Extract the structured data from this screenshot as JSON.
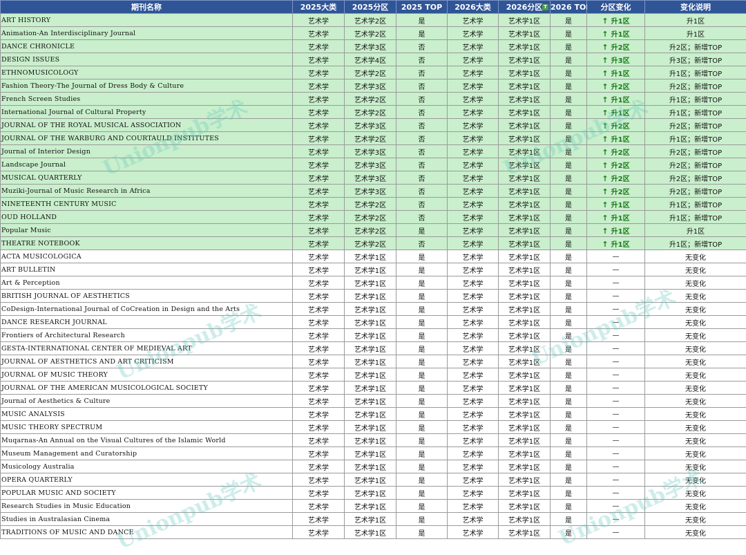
{
  "headers": [
    "期刊名称",
    "2025大类",
    "2025分区",
    "2025 TOP",
    "2026大类",
    "2026分区",
    "2026 TOP",
    "分区变化",
    "变化说明"
  ],
  "filter_icon": "filter-icon",
  "colors": {
    "header_bg": "#2f5597",
    "up_row_bg": "#c9efcc",
    "up_text": "#1a7a1a"
  },
  "watermark": "Unionpub学术",
  "rows": [
    {
      "name": "ART HISTORY",
      "c25": "艺术学",
      "q25": "艺术学2区",
      "t25": "是",
      "c26": "艺术学",
      "q26": "艺术学1区",
      "t26": "是",
      "chg": "升1区",
      "note": "升1区",
      "up": true
    },
    {
      "name": "Animation-An Interdisciplinary Journal",
      "c25": "艺术学",
      "q25": "艺术学2区",
      "t25": "是",
      "c26": "艺术学",
      "q26": "艺术学1区",
      "t26": "是",
      "chg": "升1区",
      "note": "升1区",
      "up": true
    },
    {
      "name": "DANCE CHRONICLE",
      "c25": "艺术学",
      "q25": "艺术学3区",
      "t25": "否",
      "c26": "艺术学",
      "q26": "艺术学1区",
      "t26": "是",
      "chg": "升2区",
      "note": "升2区；新增TOP",
      "up": true
    },
    {
      "name": "DESIGN ISSUES",
      "c25": "艺术学",
      "q25": "艺术学4区",
      "t25": "否",
      "c26": "艺术学",
      "q26": "艺术学1区",
      "t26": "是",
      "chg": "升3区",
      "note": "升3区；新增TOP",
      "up": true
    },
    {
      "name": "ETHNOMUSICOLOGY",
      "c25": "艺术学",
      "q25": "艺术学2区",
      "t25": "否",
      "c26": "艺术学",
      "q26": "艺术学1区",
      "t26": "是",
      "chg": "升1区",
      "note": "升1区；新增TOP",
      "up": true
    },
    {
      "name": "Fashion Theory-The Journal of Dress Body & Culture",
      "c25": "艺术学",
      "q25": "艺术学3区",
      "t25": "否",
      "c26": "艺术学",
      "q26": "艺术学1区",
      "t26": "是",
      "chg": "升2区",
      "note": "升2区；新增TOP",
      "up": true
    },
    {
      "name": "French Screen Studies",
      "c25": "艺术学",
      "q25": "艺术学2区",
      "t25": "否",
      "c26": "艺术学",
      "q26": "艺术学1区",
      "t26": "是",
      "chg": "升1区",
      "note": "升1区；新增TOP",
      "up": true
    },
    {
      "name": "International Journal of Cultural Property",
      "c25": "艺术学",
      "q25": "艺术学2区",
      "t25": "否",
      "c26": "艺术学",
      "q26": "艺术学1区",
      "t26": "是",
      "chg": "升1区",
      "note": "升1区；新增TOP",
      "up": true
    },
    {
      "name": "JOURNAL OF THE ROYAL MUSICAL ASSOCIATION",
      "c25": "艺术学",
      "q25": "艺术学3区",
      "t25": "否",
      "c26": "艺术学",
      "q26": "艺术学1区",
      "t26": "是",
      "chg": "升2区",
      "note": "升2区；新增TOP",
      "up": true
    },
    {
      "name": "JOURNAL OF THE WARBURG AND COURTAULD INSTITUTES",
      "c25": "艺术学",
      "q25": "艺术学2区",
      "t25": "否",
      "c26": "艺术学",
      "q26": "艺术学1区",
      "t26": "是",
      "chg": "升1区",
      "note": "升1区；新增TOP",
      "up": true
    },
    {
      "name": "Journal of Interior Design",
      "c25": "艺术学",
      "q25": "艺术学3区",
      "t25": "否",
      "c26": "艺术学",
      "q26": "艺术学1区",
      "t26": "是",
      "chg": "升2区",
      "note": "升2区；新增TOP",
      "up": true
    },
    {
      "name": "Landscape Journal",
      "c25": "艺术学",
      "q25": "艺术学3区",
      "t25": "否",
      "c26": "艺术学",
      "q26": "艺术学1区",
      "t26": "是",
      "chg": "升2区",
      "note": "升2区；新增TOP",
      "up": true
    },
    {
      "name": "MUSICAL QUARTERLY",
      "c25": "艺术学",
      "q25": "艺术学3区",
      "t25": "否",
      "c26": "艺术学",
      "q26": "艺术学1区",
      "t26": "是",
      "chg": "升2区",
      "note": "升2区；新增TOP",
      "up": true
    },
    {
      "name": "Muziki-Journal of Music Research in Africa",
      "c25": "艺术学",
      "q25": "艺术学3区",
      "t25": "否",
      "c26": "艺术学",
      "q26": "艺术学1区",
      "t26": "是",
      "chg": "升2区",
      "note": "升2区；新增TOP",
      "up": true
    },
    {
      "name": "NINETEENTH CENTURY MUSIC",
      "c25": "艺术学",
      "q25": "艺术学2区",
      "t25": "否",
      "c26": "艺术学",
      "q26": "艺术学1区",
      "t26": "是",
      "chg": "升1区",
      "note": "升1区；新增TOP",
      "up": true
    },
    {
      "name": "OUD HOLLAND",
      "c25": "艺术学",
      "q25": "艺术学2区",
      "t25": "否",
      "c26": "艺术学",
      "q26": "艺术学1区",
      "t26": "是",
      "chg": "升1区",
      "note": "升1区；新增TOP",
      "up": true
    },
    {
      "name": "Popular Music",
      "c25": "艺术学",
      "q25": "艺术学2区",
      "t25": "是",
      "c26": "艺术学",
      "q26": "艺术学1区",
      "t26": "是",
      "chg": "升1区",
      "note": "升1区",
      "up": true
    },
    {
      "name": "THEATRE NOTEBOOK",
      "c25": "艺术学",
      "q25": "艺术学2区",
      "t25": "否",
      "c26": "艺术学",
      "q26": "艺术学1区",
      "t26": "是",
      "chg": "升1区",
      "note": "升1区；新增TOP",
      "up": true
    },
    {
      "name": "ACTA MUSICOLOGICA",
      "c25": "艺术学",
      "q25": "艺术学1区",
      "t25": "是",
      "c26": "艺术学",
      "q26": "艺术学1区",
      "t26": "是",
      "chg": "—",
      "note": "无变化",
      "up": false
    },
    {
      "name": "ART BULLETIN",
      "c25": "艺术学",
      "q25": "艺术学1区",
      "t25": "是",
      "c26": "艺术学",
      "q26": "艺术学1区",
      "t26": "是",
      "chg": "—",
      "note": "无变化",
      "up": false
    },
    {
      "name": "Art & Perception",
      "c25": "艺术学",
      "q25": "艺术学1区",
      "t25": "是",
      "c26": "艺术学",
      "q26": "艺术学1区",
      "t26": "是",
      "chg": "—",
      "note": "无变化",
      "up": false
    },
    {
      "name": "BRITISH JOURNAL OF AESTHETICS",
      "c25": "艺术学",
      "q25": "艺术学1区",
      "t25": "是",
      "c26": "艺术学",
      "q26": "艺术学1区",
      "t26": "是",
      "chg": "—",
      "note": "无变化",
      "up": false
    },
    {
      "name": "CoDesign-International Journal of CoCreation in Design and the Arts",
      "c25": "艺术学",
      "q25": "艺术学1区",
      "t25": "是",
      "c26": "艺术学",
      "q26": "艺术学1区",
      "t26": "是",
      "chg": "—",
      "note": "无变化",
      "up": false
    },
    {
      "name": "DANCE RESEARCH JOURNAL",
      "c25": "艺术学",
      "q25": "艺术学1区",
      "t25": "是",
      "c26": "艺术学",
      "q26": "艺术学1区",
      "t26": "是",
      "chg": "—",
      "note": "无变化",
      "up": false
    },
    {
      "name": "Frontiers of Architectural Research",
      "c25": "艺术学",
      "q25": "艺术学1区",
      "t25": "是",
      "c26": "艺术学",
      "q26": "艺术学1区",
      "t26": "是",
      "chg": "—",
      "note": "无变化",
      "up": false
    },
    {
      "name": "GESTA-INTERNATIONAL CENTER OF MEDIEVAL ART",
      "c25": "艺术学",
      "q25": "艺术学1区",
      "t25": "是",
      "c26": "艺术学",
      "q26": "艺术学1区",
      "t26": "是",
      "chg": "—",
      "note": "无变化",
      "up": false
    },
    {
      "name": "JOURNAL OF AESTHETICS AND ART CRITICISM",
      "c25": "艺术学",
      "q25": "艺术学1区",
      "t25": "是",
      "c26": "艺术学",
      "q26": "艺术学1区",
      "t26": "是",
      "chg": "—",
      "note": "无变化",
      "up": false
    },
    {
      "name": "JOURNAL OF MUSIC THEORY",
      "c25": "艺术学",
      "q25": "艺术学1区",
      "t25": "是",
      "c26": "艺术学",
      "q26": "艺术学1区",
      "t26": "是",
      "chg": "—",
      "note": "无变化",
      "up": false
    },
    {
      "name": "JOURNAL OF THE AMERICAN MUSICOLOGICAL SOCIETY",
      "c25": "艺术学",
      "q25": "艺术学1区",
      "t25": "是",
      "c26": "艺术学",
      "q26": "艺术学1区",
      "t26": "是",
      "chg": "—",
      "note": "无变化",
      "up": false
    },
    {
      "name": "Journal of Aesthetics & Culture",
      "c25": "艺术学",
      "q25": "艺术学1区",
      "t25": "是",
      "c26": "艺术学",
      "q26": "艺术学1区",
      "t26": "是",
      "chg": "—",
      "note": "无变化",
      "up": false
    },
    {
      "name": "MUSIC ANALYSIS",
      "c25": "艺术学",
      "q25": "艺术学1区",
      "t25": "是",
      "c26": "艺术学",
      "q26": "艺术学1区",
      "t26": "是",
      "chg": "—",
      "note": "无变化",
      "up": false
    },
    {
      "name": "MUSIC THEORY SPECTRUM",
      "c25": "艺术学",
      "q25": "艺术学1区",
      "t25": "是",
      "c26": "艺术学",
      "q26": "艺术学1区",
      "t26": "是",
      "chg": "—",
      "note": "无变化",
      "up": false
    },
    {
      "name": "Muqarnas-An Annual on the Visual Cultures of the Islamic World",
      "c25": "艺术学",
      "q25": "艺术学1区",
      "t25": "是",
      "c26": "艺术学",
      "q26": "艺术学1区",
      "t26": "是",
      "chg": "—",
      "note": "无变化",
      "up": false
    },
    {
      "name": "Museum Management and Curatorship",
      "c25": "艺术学",
      "q25": "艺术学1区",
      "t25": "是",
      "c26": "艺术学",
      "q26": "艺术学1区",
      "t26": "是",
      "chg": "—",
      "note": "无变化",
      "up": false
    },
    {
      "name": "Musicology Australia",
      "c25": "艺术学",
      "q25": "艺术学1区",
      "t25": "是",
      "c26": "艺术学",
      "q26": "艺术学1区",
      "t26": "是",
      "chg": "—",
      "note": "无变化",
      "up": false
    },
    {
      "name": "OPERA QUARTERLY",
      "c25": "艺术学",
      "q25": "艺术学1区",
      "t25": "是",
      "c26": "艺术学",
      "q26": "艺术学1区",
      "t26": "是",
      "chg": "—",
      "note": "无变化",
      "up": false
    },
    {
      "name": "POPULAR MUSIC AND SOCIETY",
      "c25": "艺术学",
      "q25": "艺术学1区",
      "t25": "是",
      "c26": "艺术学",
      "q26": "艺术学1区",
      "t26": "是",
      "chg": "—",
      "note": "无变化",
      "up": false
    },
    {
      "name": "Research Studies in Music Education",
      "c25": "艺术学",
      "q25": "艺术学1区",
      "t25": "是",
      "c26": "艺术学",
      "q26": "艺术学1区",
      "t26": "是",
      "chg": "—",
      "note": "无变化",
      "up": false
    },
    {
      "name": "Studies in Australasian Cinema",
      "c25": "艺术学",
      "q25": "艺术学1区",
      "t25": "是",
      "c26": "艺术学",
      "q26": "艺术学1区",
      "t26": "是",
      "chg": "—",
      "note": "无变化",
      "up": false
    },
    {
      "name": "TRADITIONS OF MUSIC AND DANCE",
      "c25": "艺术学",
      "q25": "艺术学1区",
      "t25": "是",
      "c26": "艺术学",
      "q26": "艺术学1区",
      "t26": "是",
      "chg": "—",
      "note": "无变化",
      "up": false
    }
  ]
}
